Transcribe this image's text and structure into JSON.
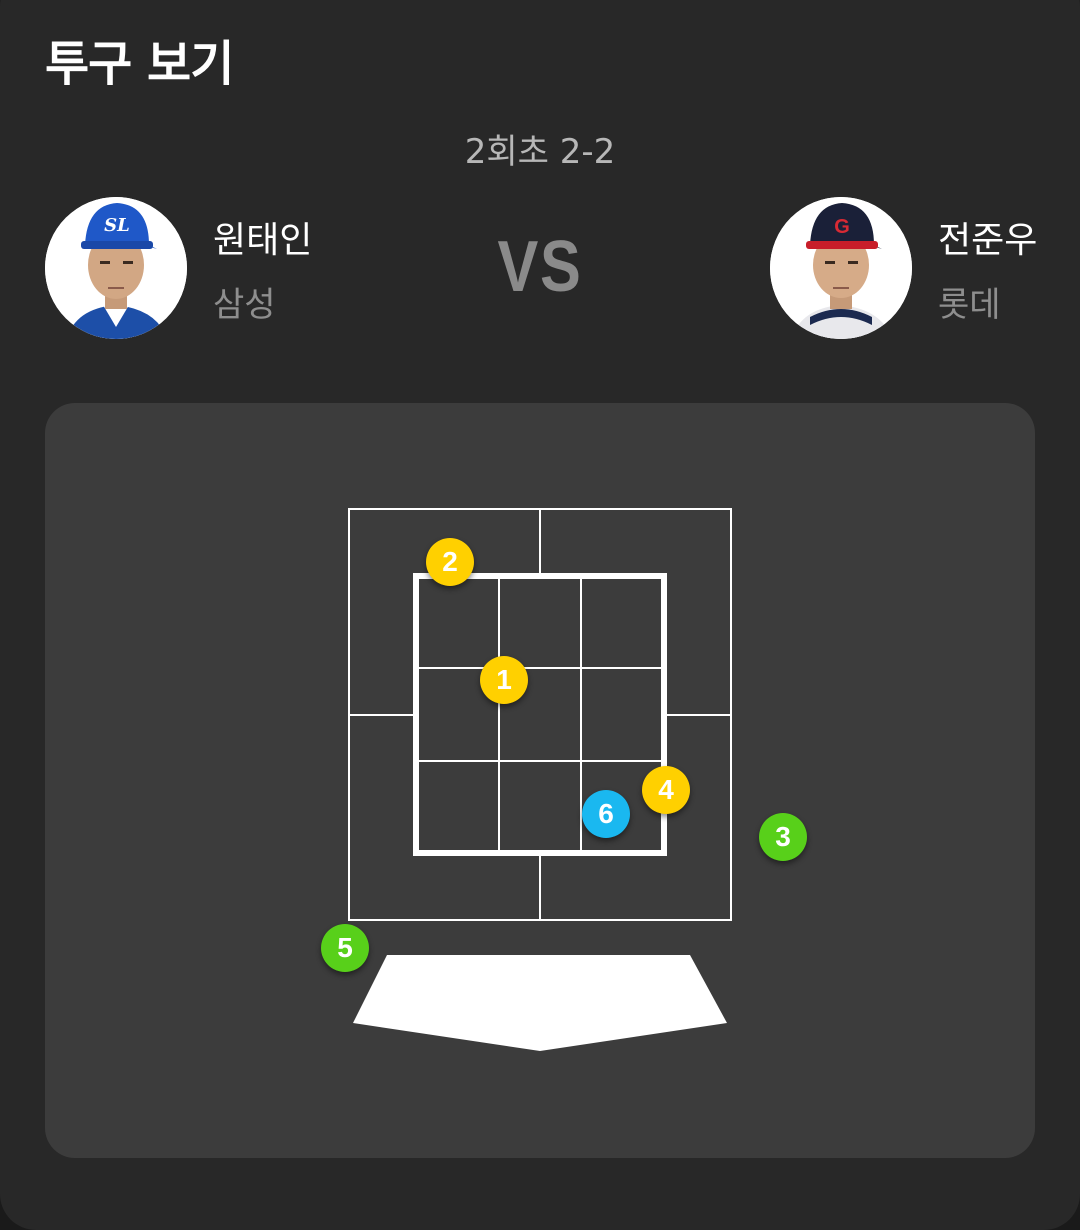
{
  "header": {
    "title": "투구 보기"
  },
  "inning": "2회초 2-2",
  "batter": {
    "name": "원태인",
    "team": "삼성",
    "cap_letters": "SL"
  },
  "pitcher": {
    "name": "전준우",
    "team": "롯데",
    "cap_letters": "G"
  },
  "vs_label": "VS",
  "colors": {
    "strike": "#ffd000",
    "ball": "#58d01a",
    "in_play": "#1ab8f0",
    "panel": "#3c3c3c",
    "background": "#282828"
  },
  "pitches": [
    {
      "number": "1",
      "result": "strike"
    },
    {
      "number": "2",
      "result": "strike"
    },
    {
      "number": "3",
      "result": "ball"
    },
    {
      "number": "4",
      "result": "strike"
    },
    {
      "number": "5",
      "result": "ball"
    },
    {
      "number": "6",
      "result": "in_play"
    }
  ]
}
